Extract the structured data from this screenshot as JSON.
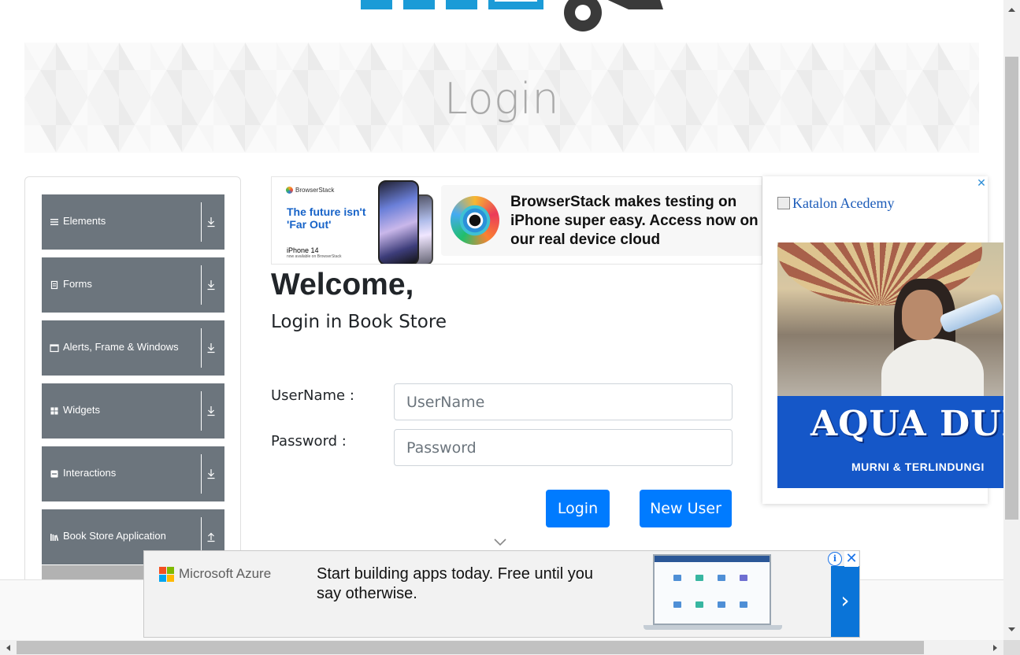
{
  "banner": {
    "title": "Login"
  },
  "sidebar": {
    "groups": [
      {
        "label": "Elements",
        "icon": "hamburger-icon",
        "arrow": "download-arrow-icon"
      },
      {
        "label": "Forms",
        "icon": "form-icon",
        "arrow": "download-arrow-icon"
      },
      {
        "label": "Alerts, Frame & Windows",
        "icon": "window-icon",
        "arrow": "download-arrow-icon"
      },
      {
        "label": "Widgets",
        "icon": "grid-icon",
        "arrow": "download-arrow-icon"
      },
      {
        "label": "Interactions",
        "icon": "interaction-icon",
        "arrow": "download-arrow-icon"
      },
      {
        "label": "Book Store Application",
        "icon": "books-icon",
        "arrow": "upload-arrow-icon"
      }
    ]
  },
  "ads": {
    "browserstack": {
      "brand": "BrowserStack",
      "tagline": "The future isn't 'Far Out'",
      "product": "iPhone 14",
      "fineprint": "now available on BrowserStack",
      "headline": "BrowserStack makes testing on iPhone super easy. Access now on our real device cloud"
    },
    "right": {
      "alt_text": "Katalon Acedemy",
      "brand": "AQUA DUNIA",
      "slogan": "MURNI & TERLINDUNGI",
      "close_glyph": "✕"
    },
    "bottom": {
      "brand": "Microsoft Azure",
      "text": "Start building apps today. Free until you say otherwise.",
      "next_glyph": "›",
      "info_glyph": "i",
      "close_glyph": "✕"
    }
  },
  "main": {
    "welcome": "Welcome,",
    "subtitle": "Login in Book Store",
    "username_label": "UserName :",
    "username_placeholder": "UserName",
    "username_value": "",
    "password_label": "Password :",
    "password_placeholder": "Password",
    "password_value": "",
    "login_button": "Login",
    "new_user_button": "New User"
  },
  "colors": {
    "primary": "#007bff",
    "sidebar_group": "#6c757d",
    "banner_title": "#a9a9a9",
    "azure_next": "#0a74d8"
  }
}
